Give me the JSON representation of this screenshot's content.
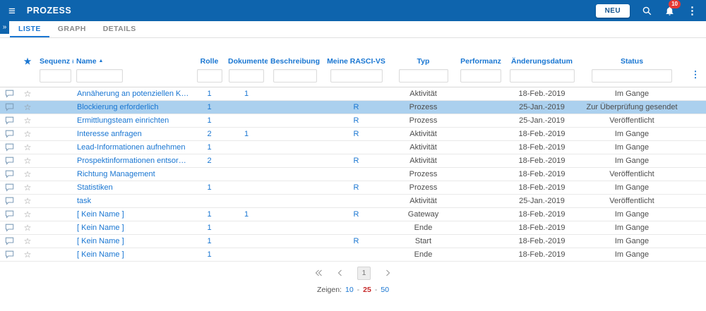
{
  "app_bar": {
    "title": "PROZESS",
    "new_button_label": "NEU",
    "notification_badge": "10"
  },
  "tabs": {
    "items": [
      {
        "label": "LISTE"
      },
      {
        "label": "GRAPH"
      },
      {
        "label": "DETAILS"
      }
    ],
    "active": "LISTE"
  },
  "table": {
    "columns": [
      {
        "label": "Sequenz #"
      },
      {
        "label": "Name",
        "sort": "asc"
      },
      {
        "label": "Rolle"
      },
      {
        "label": "Dokumente"
      },
      {
        "label": "Beschreibung"
      },
      {
        "label": "Meine RASCI-VS"
      },
      {
        "label": "Typ"
      },
      {
        "label": "Performanz"
      },
      {
        "label": "Änderungsdatum"
      },
      {
        "label": "Status"
      }
    ],
    "rows": [
      {
        "sequenz": "",
        "name": "Annäherung an potenziellen Kunden",
        "rolle": "1",
        "dokumente": "1",
        "beschreibung": "",
        "rasci": "",
        "typ": "Aktivität",
        "performanz": "",
        "datum": "18-Feb.-2019",
        "status": "Im Gange"
      },
      {
        "sequenz": "",
        "name": "Blockierung erforderlich",
        "rolle": "1",
        "dokumente": "",
        "beschreibung": "",
        "rasci": "R",
        "typ": "Prozess",
        "performanz": "",
        "datum": "25-Jan.-2019",
        "status": "Zur Überprüfung gesendet",
        "selected": true
      },
      {
        "sequenz": "",
        "name": "Ermittlungsteam einrichten",
        "rolle": "1",
        "dokumente": "",
        "beschreibung": "",
        "rasci": "R",
        "typ": "Prozess",
        "performanz": "",
        "datum": "25-Jan.-2019",
        "status": "Veröffentlicht"
      },
      {
        "sequenz": "",
        "name": "Interesse anfragen",
        "rolle": "2",
        "dokumente": "1",
        "beschreibung": "",
        "rasci": "R",
        "typ": "Aktivität",
        "performanz": "",
        "datum": "18-Feb.-2019",
        "status": "Im Gange"
      },
      {
        "sequenz": "",
        "name": "Lead-Informationen aufnehmen",
        "rolle": "1",
        "dokumente": "",
        "beschreibung": "",
        "rasci": "",
        "typ": "Aktivität",
        "performanz": "",
        "datum": "18-Feb.-2019",
        "status": "Im Gange"
      },
      {
        "sequenz": "",
        "name": "Prospektinformationen entsorgen",
        "rolle": "2",
        "dokumente": "",
        "beschreibung": "",
        "rasci": "R",
        "typ": "Aktivität",
        "performanz": "",
        "datum": "18-Feb.-2019",
        "status": "Im Gange"
      },
      {
        "sequenz": "",
        "name": "Richtung Management",
        "rolle": "",
        "dokumente": "",
        "beschreibung": "",
        "rasci": "",
        "typ": "Prozess",
        "performanz": "",
        "datum": "18-Feb.-2019",
        "status": "Veröffentlicht"
      },
      {
        "sequenz": "",
        "name": "Statistiken",
        "rolle": "1",
        "dokumente": "",
        "beschreibung": "",
        "rasci": "R",
        "typ": "Prozess",
        "performanz": "",
        "datum": "18-Feb.-2019",
        "status": "Im Gange"
      },
      {
        "sequenz": "",
        "name": "task",
        "rolle": "",
        "dokumente": "",
        "beschreibung": "",
        "rasci": "",
        "typ": "Aktivität",
        "performanz": "",
        "datum": "25-Jan.-2019",
        "status": "Veröffentlicht"
      },
      {
        "sequenz": "",
        "name": "[ Kein Name ]",
        "rolle": "1",
        "dokumente": "1",
        "beschreibung": "",
        "rasci": "R",
        "typ": "Gateway",
        "performanz": "",
        "datum": "18-Feb.-2019",
        "status": "Im Gange"
      },
      {
        "sequenz": "",
        "name": "[ Kein Name ]",
        "rolle": "1",
        "dokumente": "",
        "beschreibung": "",
        "rasci": "",
        "typ": "Ende",
        "performanz": "",
        "datum": "18-Feb.-2019",
        "status": "Im Gange"
      },
      {
        "sequenz": "",
        "name": "[ Kein Name ]",
        "rolle": "1",
        "dokumente": "",
        "beschreibung": "",
        "rasci": "R",
        "typ": "Start",
        "performanz": "",
        "datum": "18-Feb.-2019",
        "status": "Im Gange"
      },
      {
        "sequenz": "",
        "name": "[ Kein Name ]",
        "rolle": "1",
        "dokumente": "",
        "beschreibung": "",
        "rasci": "",
        "typ": "Ende",
        "performanz": "",
        "datum": "18-Feb.-2019",
        "status": "Im Gange"
      }
    ]
  },
  "pagination": {
    "current_page": "1",
    "show_label": "Zeigen:",
    "page_sizes": [
      "10",
      "25",
      "50"
    ],
    "selected_page_size": "25",
    "separator": "-"
  },
  "icons": {
    "hamburger": "≡",
    "star_filled": "★",
    "star_outline": "☆",
    "more_vertical": "⋮",
    "sort_asc": "▲",
    "sidebar_expand": "»"
  }
}
